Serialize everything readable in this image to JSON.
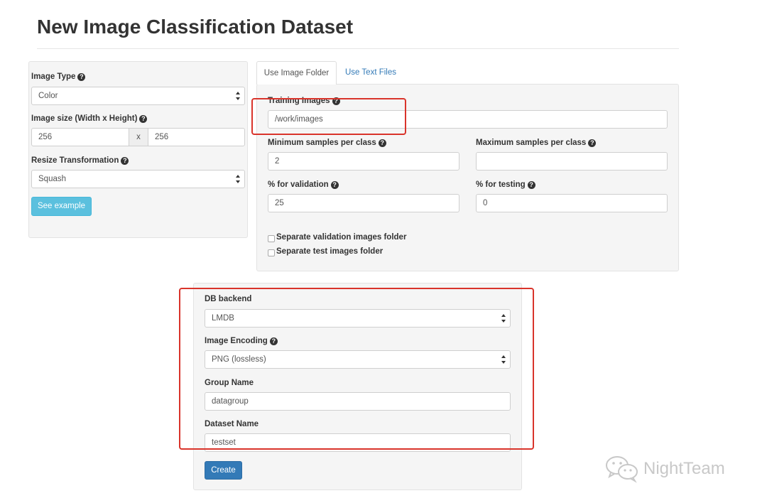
{
  "page": {
    "title": "New Image Classification Dataset"
  },
  "left_panel": {
    "image_type": {
      "label": "Image Type",
      "value": "Color"
    },
    "image_size": {
      "label": "Image size (Width x Height)",
      "width": "256",
      "separator": "x",
      "height": "256"
    },
    "resize": {
      "label": "Resize Transformation",
      "value": "Squash"
    },
    "see_example_label": "See example"
  },
  "tabs": [
    {
      "label": "Use Image Folder",
      "active": true
    },
    {
      "label": "Use Text Files",
      "active": false
    }
  ],
  "folder_panel": {
    "training_images": {
      "label": "Training Images",
      "value": "/work/images"
    },
    "min_samples": {
      "label": "Minimum samples per class",
      "value": "2"
    },
    "max_samples": {
      "label": "Maximum samples per class",
      "value": ""
    },
    "pct_validation": {
      "label": "% for validation",
      "value": "25"
    },
    "pct_testing": {
      "label": "% for testing",
      "value": "0"
    },
    "separate_validation": {
      "label": "Separate validation images folder",
      "checked": false
    },
    "separate_test": {
      "label": "Separate test images folder",
      "checked": false
    }
  },
  "db_panel": {
    "db_backend": {
      "label": "DB backend",
      "value": "LMDB"
    },
    "image_encoding": {
      "label": "Image Encoding",
      "value": "PNG (lossless)"
    },
    "group_name": {
      "label": "Group Name",
      "value": "datagroup"
    },
    "dataset_name": {
      "label": "Dataset Name",
      "value": "testset"
    },
    "create_label": "Create"
  },
  "help_glyph": "?",
  "watermark": {
    "text": "NightTeam",
    "icon": "wechat-icon"
  },
  "colors": {
    "highlight": "#d9342b",
    "primary": "#337ab7",
    "info": "#5bc0de"
  }
}
